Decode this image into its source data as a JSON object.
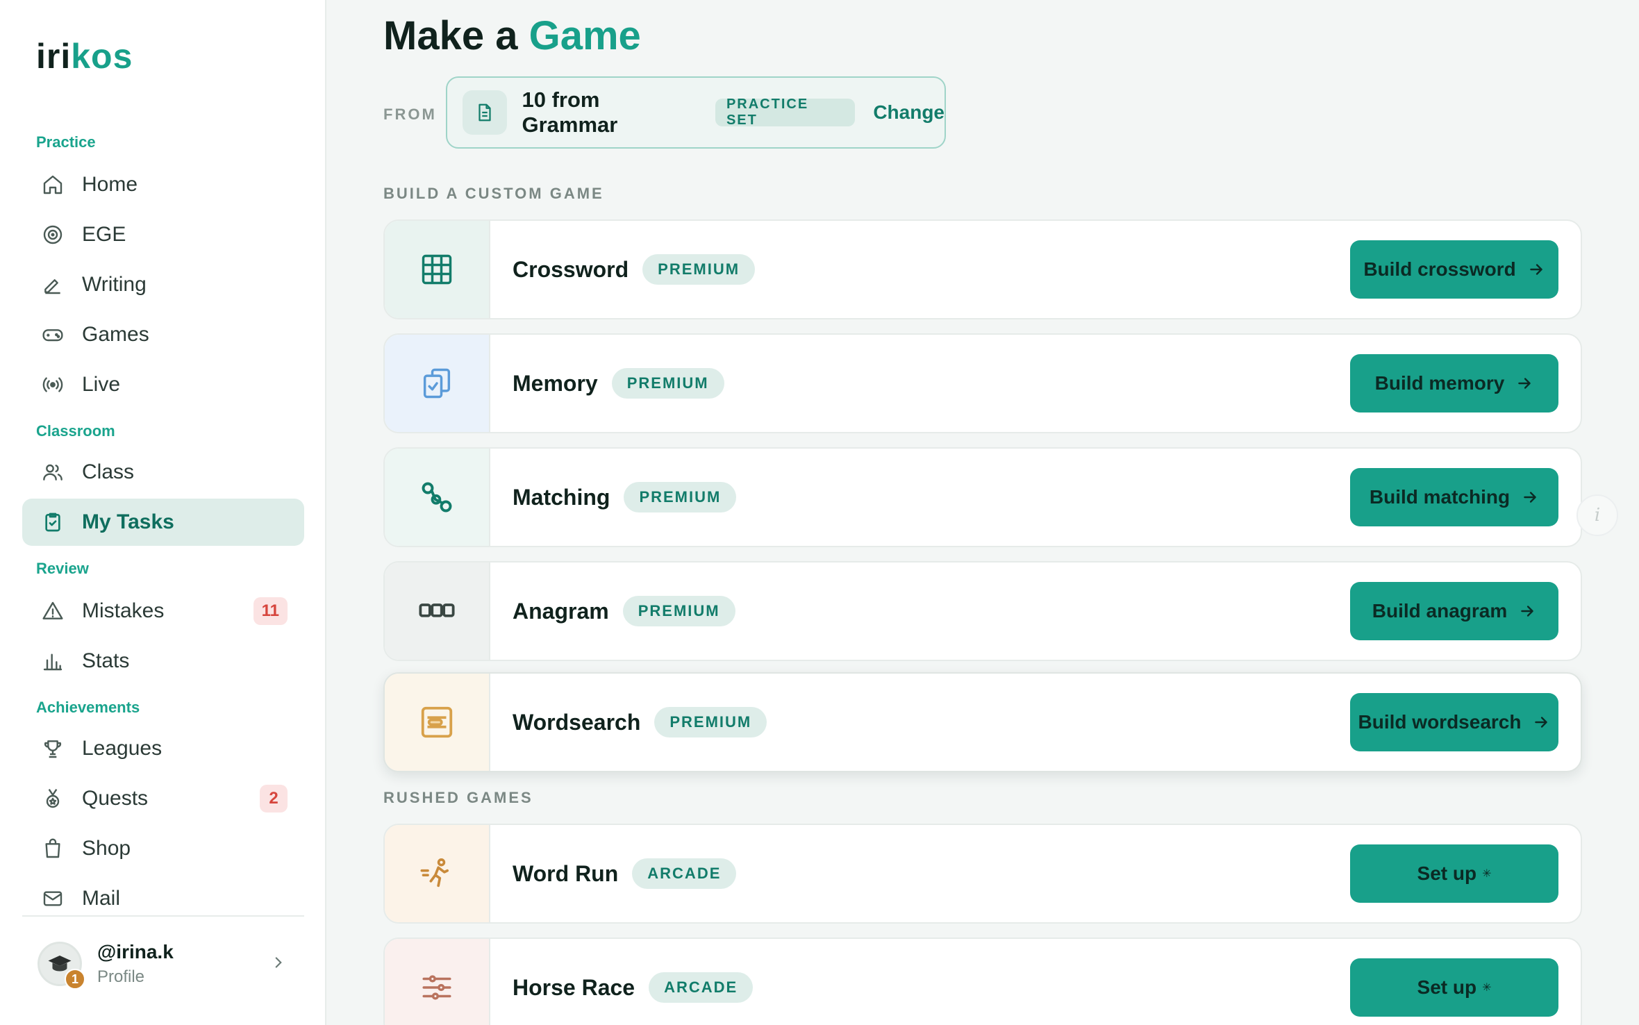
{
  "brand": {
    "logo_part1": "iri",
    "logo_part2": "kos"
  },
  "sidebar": {
    "sections": [
      {
        "label": "Practice"
      },
      {
        "label": "Classroom"
      },
      {
        "label": "Review"
      },
      {
        "label": "Achievements"
      }
    ],
    "items": [
      {
        "label": "Home",
        "icon": "home-icon"
      },
      {
        "label": "EGE",
        "icon": "target-icon"
      },
      {
        "label": "Writing",
        "icon": "pen-icon"
      },
      {
        "label": "Games",
        "icon": "gamepad-icon"
      },
      {
        "label": "Live",
        "icon": "broadcast-icon"
      },
      {
        "label": "Class",
        "icon": "users-icon"
      },
      {
        "label": "My Tasks",
        "icon": "clipboard-check-icon",
        "active": true
      },
      {
        "label": "Mistakes",
        "icon": "warning-icon",
        "badge": "11"
      },
      {
        "label": "Stats",
        "icon": "bar-chart-icon"
      },
      {
        "label": "Leagues",
        "icon": "trophy-icon"
      },
      {
        "label": "Quests",
        "icon": "medal-icon",
        "badge": "2"
      },
      {
        "label": "Shop",
        "icon": "shopping-bag-icon"
      },
      {
        "label": "Mail",
        "icon": "mail-icon"
      }
    ],
    "profile": {
      "handle": "@irina.k",
      "subtitle": "Profile",
      "level": "1"
    }
  },
  "header": {
    "title_part1": "Make a",
    "title_part2": "Game",
    "from_label": "FROM",
    "source": {
      "name": "10 from Grammar",
      "tag": "PRACTICE SET",
      "change_label": "Change"
    }
  },
  "custom_games": {
    "label": "BUILD A CUSTOM GAME",
    "items": [
      {
        "name": "Crossword",
        "tag": "PREMIUM",
        "button": "Build crossword",
        "icon": "grid-icon"
      },
      {
        "name": "Memory",
        "tag": "PREMIUM",
        "button": "Build memory",
        "icon": "cards-icon"
      },
      {
        "name": "Matching",
        "tag": "PREMIUM",
        "button": "Build matching",
        "icon": "link-nodes-icon"
      },
      {
        "name": "Anagram",
        "tag": "PREMIUM",
        "button": "Build anagram",
        "icon": "letter-tiles-icon"
      },
      {
        "name": "Wordsearch",
        "tag": "PREMIUM",
        "button": "Build wordsearch",
        "icon": "search-box-icon"
      }
    ]
  },
  "rushed_games": {
    "label": "RUSHED GAMES",
    "items": [
      {
        "name": "Word Run",
        "tag": "ARCADE",
        "button": "Set up",
        "icon": "runner-icon"
      },
      {
        "name": "Horse Race",
        "tag": "ARCADE",
        "button": "Set up",
        "icon": "sliders-icon"
      }
    ]
  },
  "colors": {
    "accent": "#18a08a",
    "accent_dark": "#127c6a",
    "badge_red": "#d6453d"
  }
}
